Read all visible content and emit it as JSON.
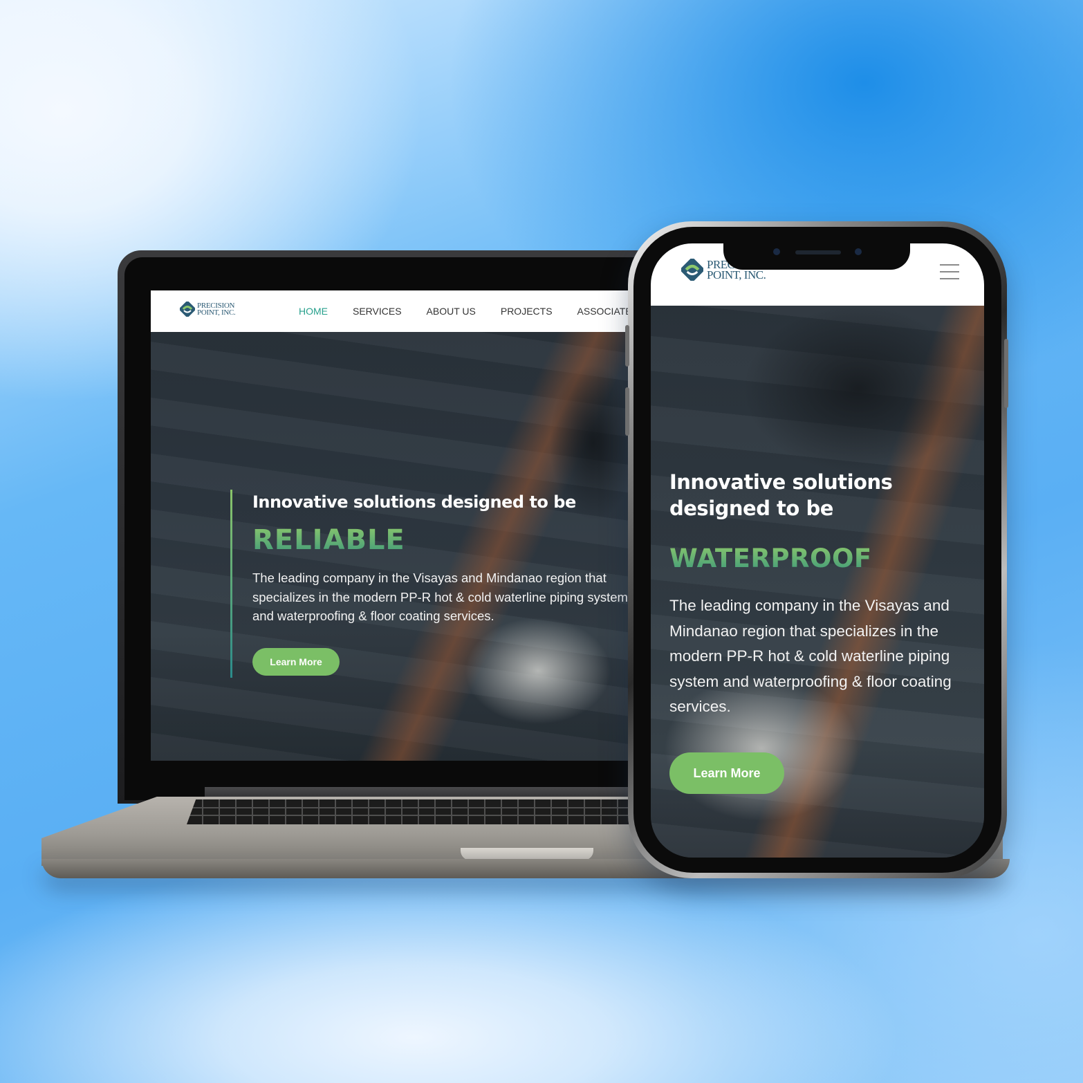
{
  "brand": {
    "logo_line1": "PRECISION",
    "logo_line2": "POINT, INC.",
    "accent_green": "#7bbf66",
    "nav_active": "#27a08c",
    "logo_blue": "#2b5a74"
  },
  "desktop": {
    "nav": {
      "items": [
        {
          "label": "HOME",
          "active": true
        },
        {
          "label": "SERVICES",
          "active": false
        },
        {
          "label": "ABOUT US",
          "active": false
        },
        {
          "label": "PROJECTS",
          "active": false
        },
        {
          "label": "ASSOCIATES",
          "active": false
        }
      ]
    },
    "hero": {
      "heading": "Innovative solutions designed to be",
      "highlight": "RELIABLE",
      "description": "The leading company in the Visayas and Mindanao region that specializes in the modern PP-R hot & cold waterline piping system and waterproofing & floor coating services.",
      "cta_label": "Learn More"
    }
  },
  "mobile": {
    "logo_line1": "PREC",
    "logo_line2": "POINT, INC.",
    "menu_icon": "hamburger-menu-icon",
    "hero": {
      "heading": "Innovative solutions designed to be",
      "highlight": "WATERPROOF",
      "description": "The leading company in the Visayas and Mindanao region that specializes in the modern PP-R hot & cold waterline piping system and waterproofing & floor coating services.",
      "cta_label": "Learn More"
    }
  }
}
